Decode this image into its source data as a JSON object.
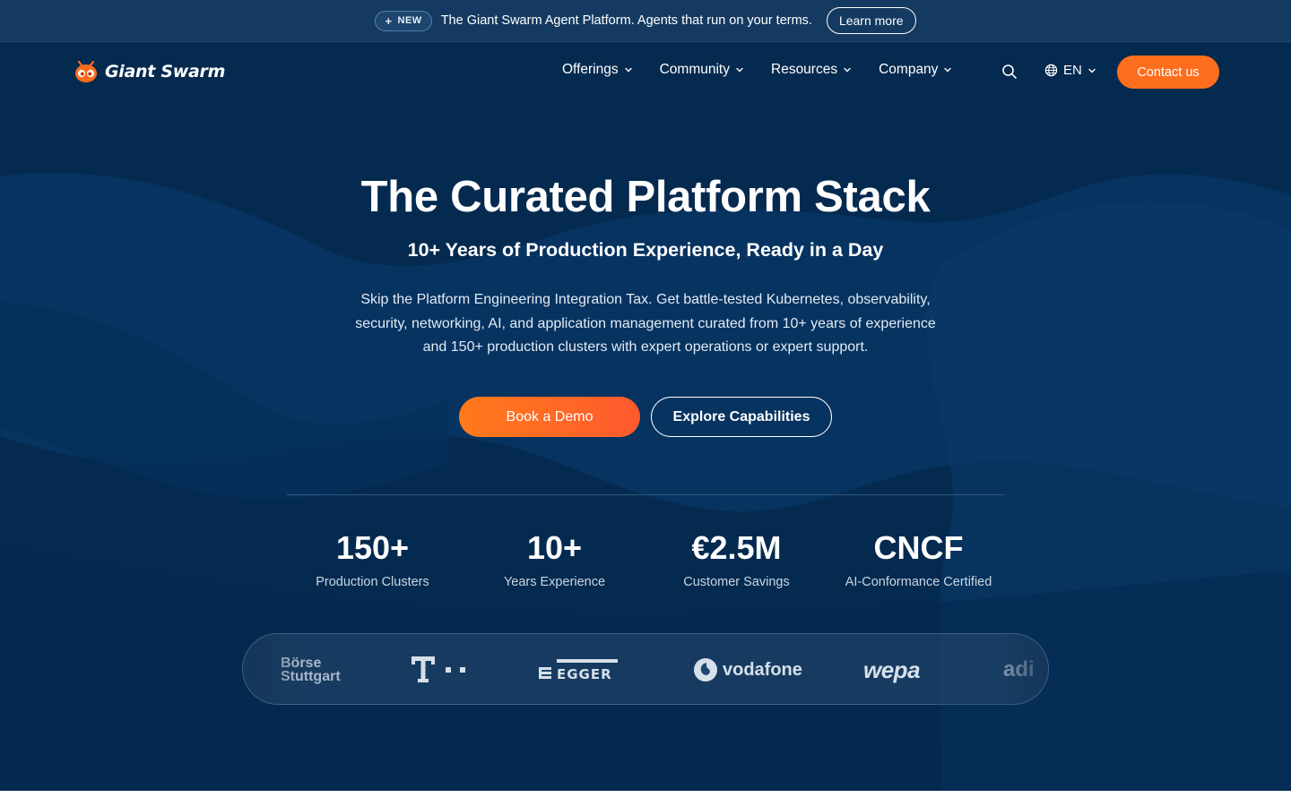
{
  "announcement": {
    "badge": "NEW",
    "text": "The Giant Swarm Agent Platform. Agents that run on your terms.",
    "cta": "Learn more"
  },
  "header": {
    "logo_text": "Giant Swarm",
    "nav": [
      {
        "label": "Offerings"
      },
      {
        "label": "Community"
      },
      {
        "label": "Resources"
      },
      {
        "label": "Company"
      }
    ],
    "language": "EN",
    "contact": "Contact us"
  },
  "hero": {
    "title": "The Curated Platform Stack",
    "subtitle": "10+ Years of Production Experience, Ready in a Day",
    "description": "Skip the Platform Engineering Integration Tax. Get battle-tested Kubernetes, observability, security, networking, AI, and application management curated from 10+ years of experience and 150+ production clusters with expert operations or expert support.",
    "primary_cta": "Book a Demo",
    "secondary_cta": "Explore Capabilities"
  },
  "stats": [
    {
      "value": "150+",
      "label": "Production Clusters"
    },
    {
      "value": "10+",
      "label": "Years Experience"
    },
    {
      "value": "€2.5M",
      "label": "Customer Savings"
    },
    {
      "value": "CNCF",
      "label": "AI-Conformance Certified"
    }
  ],
  "customers": {
    "boerse_line1": "Börse",
    "boerse_line2": "Stuttgart",
    "telekom": "T",
    "egger": "EGGER",
    "vodafone": "vodafone",
    "wepa": "wepa",
    "adidas": "adi"
  },
  "colors": {
    "hero_bg": "#052a4f",
    "announcement_bg": "#143a61",
    "accent_orange": "#ff6e1d",
    "stat_label": "#c9d6e4"
  }
}
